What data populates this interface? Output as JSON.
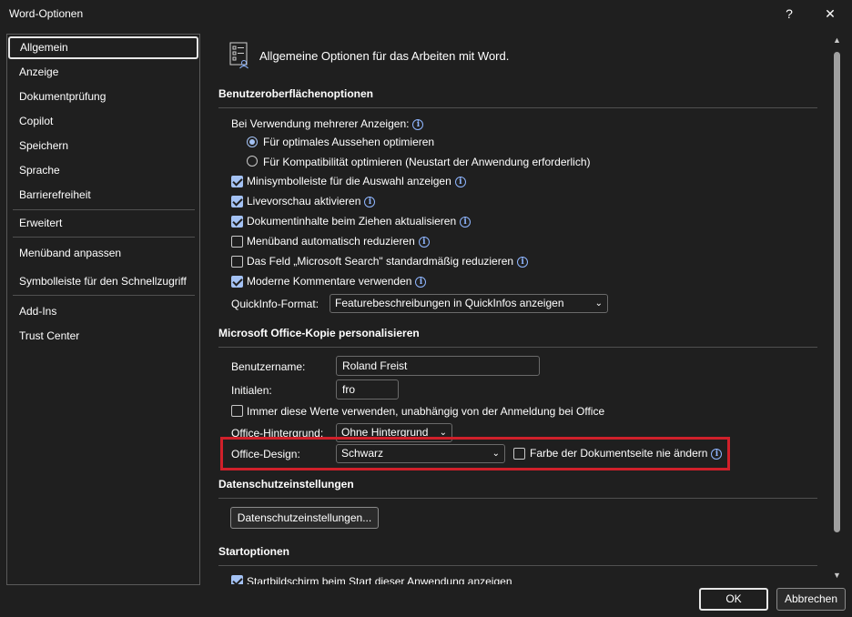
{
  "window": {
    "title": "Word-Optionen",
    "help_label": "?",
    "close_label": "✕"
  },
  "sidebar": {
    "items": [
      {
        "label": "Allgemein"
      },
      {
        "label": "Anzeige"
      },
      {
        "label": "Dokumentprüfung"
      },
      {
        "label": "Copilot"
      },
      {
        "label": "Speichern"
      },
      {
        "label": "Sprache"
      },
      {
        "label": "Barrierefreiheit"
      },
      {
        "label": "Erweitert"
      },
      {
        "label": "Menüband anpassen"
      },
      {
        "label": "Symbolleiste für den Schnellzugriff"
      },
      {
        "label": "Add-Ins"
      },
      {
        "label": "Trust Center"
      }
    ],
    "selected": "Allgemein"
  },
  "header": {
    "icon": "general-options-icon",
    "title": "Allgemeine Optionen für das Arbeiten mit Word."
  },
  "sections": {
    "ui": {
      "title": "Benutzeroberflächenoptionen",
      "multi_display_label": "Bei Verwendung mehrerer Anzeigen:",
      "radio_optimal": "Für optimales Aussehen optimieren",
      "radio_compat": "Für Kompatibilität optimieren (Neustart der Anwendung erforderlich)",
      "cb_mini_toolbar": "Minisymbolleiste für die Auswahl anzeigen",
      "cb_live_preview": "Livevorschau aktivieren",
      "cb_drag_update": "Dokumentinhalte beim Ziehen aktualisieren",
      "cb_collapse_ribbon": "Menüband automatisch reduzieren",
      "cb_search_collapse": "Das Feld „Microsoft Search\" standardmäßig reduzieren",
      "cb_modern_comments": "Moderne Kommentare verwenden",
      "tooltip_label": "QuickInfo-Format:",
      "tooltip_value": "Featurebeschreibungen in QuickInfos anzeigen"
    },
    "personalize": {
      "title": "Microsoft Office-Kopie personalisieren",
      "username_label": "Benutzername:",
      "username_value": "Roland Freist",
      "initials_label": "Initialen:",
      "initials_value": "fro",
      "cb_always_use": "Immer diese Werte verwenden, unabhängig von der Anmeldung bei Office",
      "background_label": "Office-Hintergrund:",
      "background_value": "Ohne Hintergrund",
      "design_label": "Office-Design:",
      "design_value": "Schwarz",
      "cb_never_change_page": "Farbe der Dokumentseite nie ändern"
    },
    "privacy": {
      "title": "Datenschutzeinstellungen",
      "button_label": "Datenschutzeinstellungen..."
    },
    "startup": {
      "title": "Startoptionen",
      "cb_start_screen": "Startbildschirm beim Start dieser Anwendung anzeigen"
    }
  },
  "footer": {
    "ok_label": "OK",
    "cancel_label": "Abbrechen"
  },
  "colors": {
    "background": "#1f1f1f",
    "accent": "#a4c2f4",
    "highlight": "#d0202a"
  }
}
